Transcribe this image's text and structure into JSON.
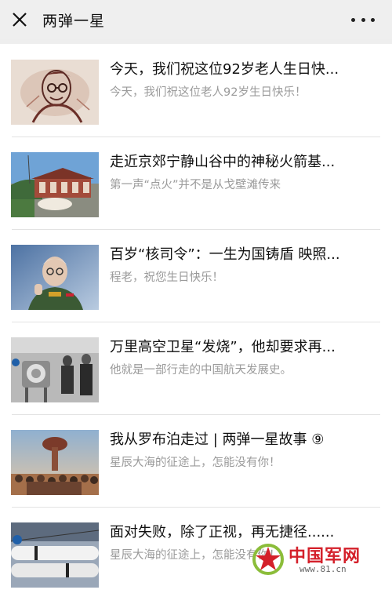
{
  "header": {
    "title": "两弹一星"
  },
  "articles": [
    {
      "title": "今天，我们祝这位92岁老人生日快...",
      "subtitle": "今天，我们祝这位老人92岁生日快乐！"
    },
    {
      "title": "走近京郊宁静山谷中的神秘火箭基...",
      "subtitle": "第一声“点火”并不是从戈壁滩传来"
    },
    {
      "title": "百岁“核司令”：一生为国铸盾 映照...",
      "subtitle": "程老，祝您生日快乐！"
    },
    {
      "title": "万里高空卫星“发烧”，他却要求再...",
      "subtitle": "他就是一部行走的中国航天发展史。"
    },
    {
      "title": "我从罗布泊走过 | 两弹一星故事 ⑨",
      "subtitle": "星辰大海的征途上，怎能没有你！"
    },
    {
      "title": "面对失败，除了正视，再无捷径......",
      "subtitle": "星辰大海的征途上，怎能没有你！"
    }
  ],
  "watermark": {
    "text": "中国军网",
    "url": "www.81.cn"
  },
  "icons": {
    "close": "close-icon",
    "more": "more-icon"
  }
}
